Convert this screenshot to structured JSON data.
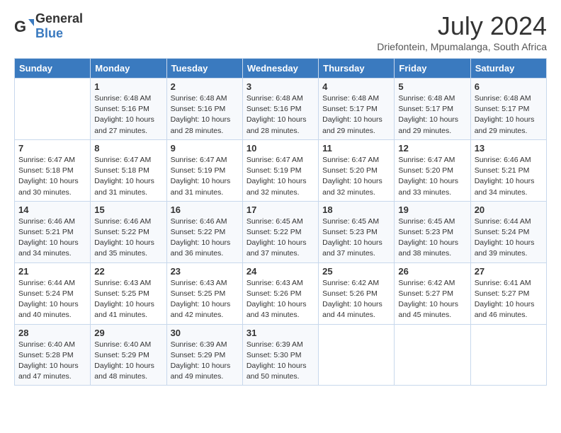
{
  "logo": {
    "text_general": "General",
    "text_blue": "Blue"
  },
  "title": "July 2024",
  "location": "Driefontein, Mpumalanga, South Africa",
  "days_of_week": [
    "Sunday",
    "Monday",
    "Tuesday",
    "Wednesday",
    "Thursday",
    "Friday",
    "Saturday"
  ],
  "weeks": [
    [
      {
        "num": "",
        "info": ""
      },
      {
        "num": "1",
        "info": "Sunrise: 6:48 AM\nSunset: 5:16 PM\nDaylight: 10 hours\nand 27 minutes."
      },
      {
        "num": "2",
        "info": "Sunrise: 6:48 AM\nSunset: 5:16 PM\nDaylight: 10 hours\nand 28 minutes."
      },
      {
        "num": "3",
        "info": "Sunrise: 6:48 AM\nSunset: 5:16 PM\nDaylight: 10 hours\nand 28 minutes."
      },
      {
        "num": "4",
        "info": "Sunrise: 6:48 AM\nSunset: 5:17 PM\nDaylight: 10 hours\nand 29 minutes."
      },
      {
        "num": "5",
        "info": "Sunrise: 6:48 AM\nSunset: 5:17 PM\nDaylight: 10 hours\nand 29 minutes."
      },
      {
        "num": "6",
        "info": "Sunrise: 6:48 AM\nSunset: 5:17 PM\nDaylight: 10 hours\nand 29 minutes."
      }
    ],
    [
      {
        "num": "7",
        "info": "Sunrise: 6:47 AM\nSunset: 5:18 PM\nDaylight: 10 hours\nand 30 minutes."
      },
      {
        "num": "8",
        "info": "Sunrise: 6:47 AM\nSunset: 5:18 PM\nDaylight: 10 hours\nand 31 minutes."
      },
      {
        "num": "9",
        "info": "Sunrise: 6:47 AM\nSunset: 5:19 PM\nDaylight: 10 hours\nand 31 minutes."
      },
      {
        "num": "10",
        "info": "Sunrise: 6:47 AM\nSunset: 5:19 PM\nDaylight: 10 hours\nand 32 minutes."
      },
      {
        "num": "11",
        "info": "Sunrise: 6:47 AM\nSunset: 5:20 PM\nDaylight: 10 hours\nand 32 minutes."
      },
      {
        "num": "12",
        "info": "Sunrise: 6:47 AM\nSunset: 5:20 PM\nDaylight: 10 hours\nand 33 minutes."
      },
      {
        "num": "13",
        "info": "Sunrise: 6:46 AM\nSunset: 5:21 PM\nDaylight: 10 hours\nand 34 minutes."
      }
    ],
    [
      {
        "num": "14",
        "info": "Sunrise: 6:46 AM\nSunset: 5:21 PM\nDaylight: 10 hours\nand 34 minutes."
      },
      {
        "num": "15",
        "info": "Sunrise: 6:46 AM\nSunset: 5:22 PM\nDaylight: 10 hours\nand 35 minutes."
      },
      {
        "num": "16",
        "info": "Sunrise: 6:46 AM\nSunset: 5:22 PM\nDaylight: 10 hours\nand 36 minutes."
      },
      {
        "num": "17",
        "info": "Sunrise: 6:45 AM\nSunset: 5:22 PM\nDaylight: 10 hours\nand 37 minutes."
      },
      {
        "num": "18",
        "info": "Sunrise: 6:45 AM\nSunset: 5:23 PM\nDaylight: 10 hours\nand 37 minutes."
      },
      {
        "num": "19",
        "info": "Sunrise: 6:45 AM\nSunset: 5:23 PM\nDaylight: 10 hours\nand 38 minutes."
      },
      {
        "num": "20",
        "info": "Sunrise: 6:44 AM\nSunset: 5:24 PM\nDaylight: 10 hours\nand 39 minutes."
      }
    ],
    [
      {
        "num": "21",
        "info": "Sunrise: 6:44 AM\nSunset: 5:24 PM\nDaylight: 10 hours\nand 40 minutes."
      },
      {
        "num": "22",
        "info": "Sunrise: 6:43 AM\nSunset: 5:25 PM\nDaylight: 10 hours\nand 41 minutes."
      },
      {
        "num": "23",
        "info": "Sunrise: 6:43 AM\nSunset: 5:25 PM\nDaylight: 10 hours\nand 42 minutes."
      },
      {
        "num": "24",
        "info": "Sunrise: 6:43 AM\nSunset: 5:26 PM\nDaylight: 10 hours\nand 43 minutes."
      },
      {
        "num": "25",
        "info": "Sunrise: 6:42 AM\nSunset: 5:26 PM\nDaylight: 10 hours\nand 44 minutes."
      },
      {
        "num": "26",
        "info": "Sunrise: 6:42 AM\nSunset: 5:27 PM\nDaylight: 10 hours\nand 45 minutes."
      },
      {
        "num": "27",
        "info": "Sunrise: 6:41 AM\nSunset: 5:27 PM\nDaylight: 10 hours\nand 46 minutes."
      }
    ],
    [
      {
        "num": "28",
        "info": "Sunrise: 6:40 AM\nSunset: 5:28 PM\nDaylight: 10 hours\nand 47 minutes."
      },
      {
        "num": "29",
        "info": "Sunrise: 6:40 AM\nSunset: 5:29 PM\nDaylight: 10 hours\nand 48 minutes."
      },
      {
        "num": "30",
        "info": "Sunrise: 6:39 AM\nSunset: 5:29 PM\nDaylight: 10 hours\nand 49 minutes."
      },
      {
        "num": "31",
        "info": "Sunrise: 6:39 AM\nSunset: 5:30 PM\nDaylight: 10 hours\nand 50 minutes."
      },
      {
        "num": "",
        "info": ""
      },
      {
        "num": "",
        "info": ""
      },
      {
        "num": "",
        "info": ""
      }
    ]
  ]
}
